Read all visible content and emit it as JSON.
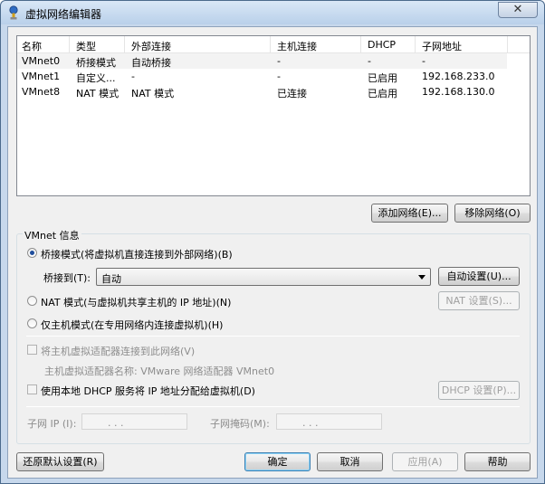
{
  "window": {
    "title": "虚拟网络编辑器",
    "close_label": "✕"
  },
  "list": {
    "columns": [
      "名称",
      "类型",
      "外部连接",
      "主机连接",
      "DHCP",
      "子网地址"
    ],
    "rows": [
      [
        "VMnet0",
        "桥接模式",
        "自动桥接",
        "-",
        "-",
        "-"
      ],
      [
        "VMnet1",
        "自定义...",
        "-",
        "-",
        "已启用",
        "192.168.233.0"
      ],
      [
        "VMnet8",
        "NAT 模式",
        "NAT 模式",
        "已连接",
        "已启用",
        "192.168.130.0"
      ]
    ]
  },
  "buttons": {
    "add_network": "添加网络(E)...",
    "remove_network": "移除网络(O)",
    "auto_settings": "自动设置(U)...",
    "nat_settings": "NAT 设置(S)...",
    "dhcp_settings": "DHCP 设置(P)...",
    "restore_defaults": "还原默认设置(R)",
    "ok": "确定",
    "cancel": "取消",
    "apply": "应用(A)",
    "help": "帮助"
  },
  "vmnet_info": {
    "title": "VMnet 信息",
    "bridged_label": "桥接模式(将虚拟机直接连接到外部网络)(B)",
    "bridged_to_label": "桥接到(T):",
    "bridged_to_value": "自动",
    "nat_label": "NAT 模式(与虚拟机共享主机的 IP 地址)(N)",
    "host_only_label": "仅主机模式(在专用网络内连接虚拟机)(H)",
    "selected_mode": "bridged",
    "connect_adapter_label": "将主机虚拟适配器连接到此网络(V)",
    "adapter_name_label": "主机虚拟适配器名称: VMware 网络适配器 VMnet0",
    "use_dhcp_label": "使用本地 DHCP 服务将 IP 地址分配给虚拟机(D)",
    "subnet_ip_label": "子网 IP (I):",
    "subnet_mask_label": "子网掩码(M):",
    "ip_dots": ". . ."
  },
  "colors": {
    "accent": "#1f4e9c",
    "titlebar": "#b9d0ea",
    "dialog_bg": "#f0f0f0"
  }
}
